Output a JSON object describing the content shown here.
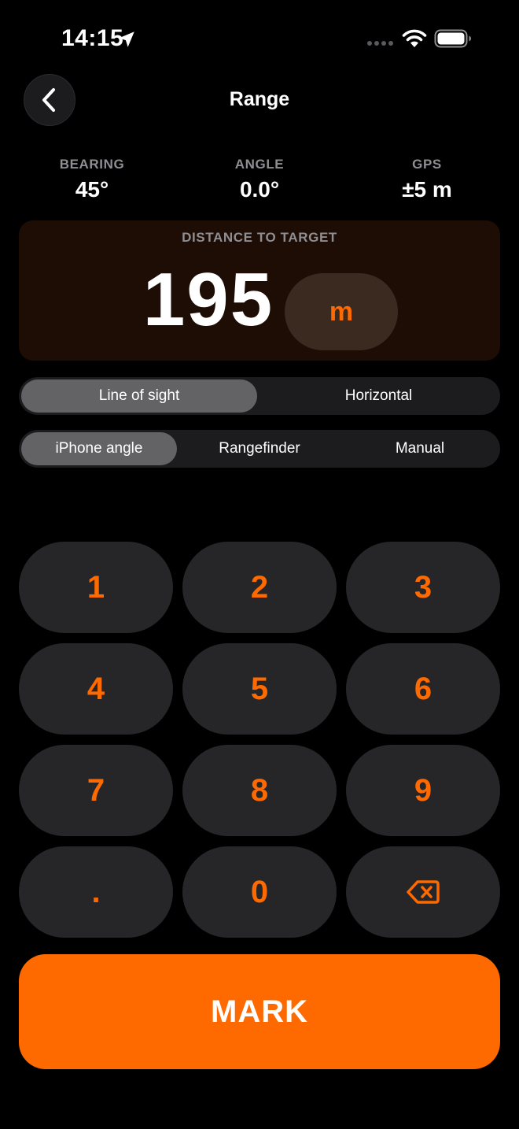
{
  "status_bar": {
    "time": "14:15",
    "icons": [
      "location-arrow-icon",
      "signal-dots-icon",
      "wifi-icon",
      "battery-icon"
    ]
  },
  "nav": {
    "title": "Range",
    "back_icon": "chevron-left-icon"
  },
  "stats": [
    {
      "label": "BEARING",
      "value": "45°"
    },
    {
      "label": "ANGLE",
      "value": "0.0°"
    },
    {
      "label": "GPS",
      "value": "±5 m"
    }
  ],
  "distance": {
    "label": "DISTANCE TO TARGET",
    "value": "195",
    "unit": "m"
  },
  "mode_segment": {
    "options": [
      "Line of sight",
      "Horizontal"
    ],
    "selected": "Line of sight"
  },
  "source_segment": {
    "options": [
      "iPhone angle",
      "Rangefinder",
      "Manual"
    ],
    "selected": "iPhone angle"
  },
  "keypad": {
    "keys": [
      "1",
      "2",
      "3",
      "4",
      "5",
      "6",
      "7",
      "8",
      "9",
      ".",
      "0"
    ],
    "backspace_icon": "backspace-icon"
  },
  "mark_button": {
    "label": "MARK"
  },
  "colors": {
    "accent": "#ff6a00",
    "background": "#000000",
    "key_background": "#262628",
    "card_background": "#1d0d04",
    "segment_selected": "#636366",
    "secondary_text": "#8e8e93"
  }
}
